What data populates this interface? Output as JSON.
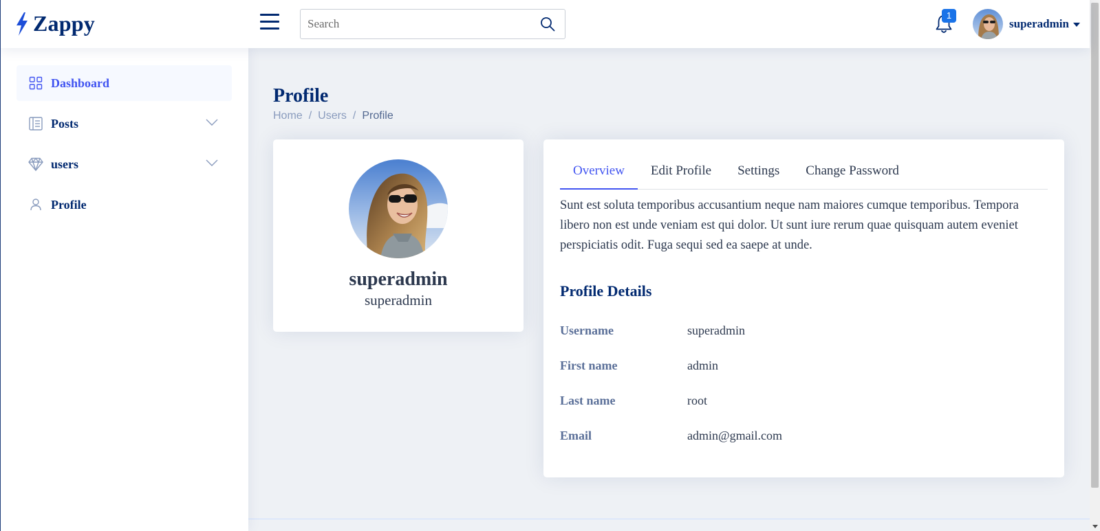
{
  "header": {
    "logo_text": "Zappy",
    "search_placeholder": "Search",
    "notification_count": "1",
    "user_name": "superadmin"
  },
  "sidebar": {
    "items": [
      {
        "label": "Dashboard",
        "icon": "grid-icon",
        "active": true
      },
      {
        "label": "Posts",
        "icon": "layout-text-icon",
        "expandable": true
      },
      {
        "label": "users",
        "icon": "gem-icon",
        "expandable": true
      },
      {
        "label": "Profile",
        "icon": "person-icon"
      }
    ]
  },
  "page": {
    "title": "Profile",
    "breadcrumb": [
      "Home",
      "Users",
      "Profile"
    ]
  },
  "profile_card": {
    "name": "superadmin",
    "subtitle": "superadmin"
  },
  "tabs": [
    "Overview",
    "Edit Profile",
    "Settings",
    "Change Password"
  ],
  "active_tab": "Overview",
  "overview": {
    "about": "Sunt est soluta temporibus accusantium neque nam maiores cumque temporibus. Tempora libero non est unde veniam est qui dolor. Ut sunt iure rerum quae quisquam autem eveniet perspiciatis odit. Fuga sequi sed ea saepe at unde.",
    "details_title": "Profile Details",
    "details": [
      {
        "label": "Username",
        "value": "superadmin"
      },
      {
        "label": "First name",
        "value": "admin"
      },
      {
        "label": "Last name",
        "value": "root"
      },
      {
        "label": "Email",
        "value": "admin@gmail.com"
      }
    ]
  },
  "colors": {
    "brand": "#012970",
    "accent": "#4154f1",
    "badge": "#1a73e8",
    "background": "#eef1f5"
  }
}
